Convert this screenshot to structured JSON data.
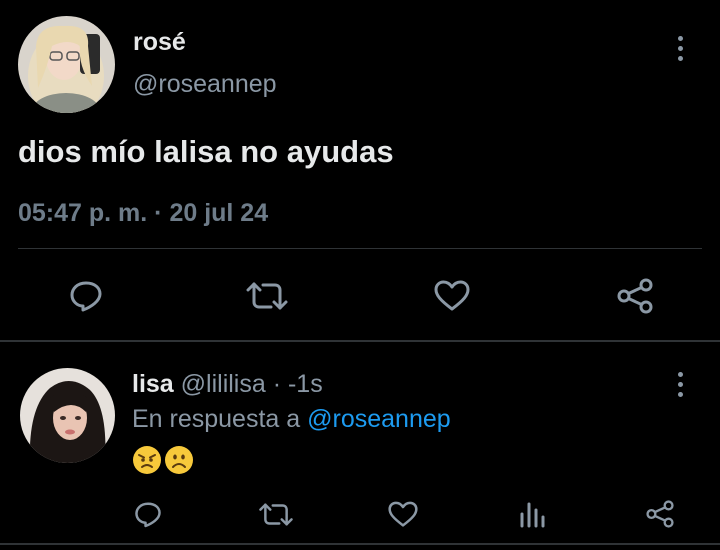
{
  "tweet": {
    "name": "rosé",
    "handle": "@roseannep",
    "text": "dios mío lalisa no ayudas",
    "timestamp": "05:47 p. m. · 20 jul 24",
    "actions": [
      "reply-icon",
      "retweet-icon",
      "like-icon",
      "share-icon"
    ]
  },
  "reply": {
    "name": "lisa",
    "handle": "@lililisa",
    "separator": " · ",
    "age": "-1s",
    "in_reply_prefix": "En respuesta a ",
    "in_reply_mention": "@roseannep",
    "emoji": [
      "angry-face",
      "frowning-face"
    ],
    "actions": [
      "reply-icon",
      "retweet-icon",
      "like-icon",
      "views-icon",
      "share-icon"
    ]
  },
  "colors": {
    "background": "#000000",
    "text": "#e7e9ea",
    "secondary": "#8b98a5",
    "mention": "#1d9bf0",
    "divider": "#2f3336"
  }
}
